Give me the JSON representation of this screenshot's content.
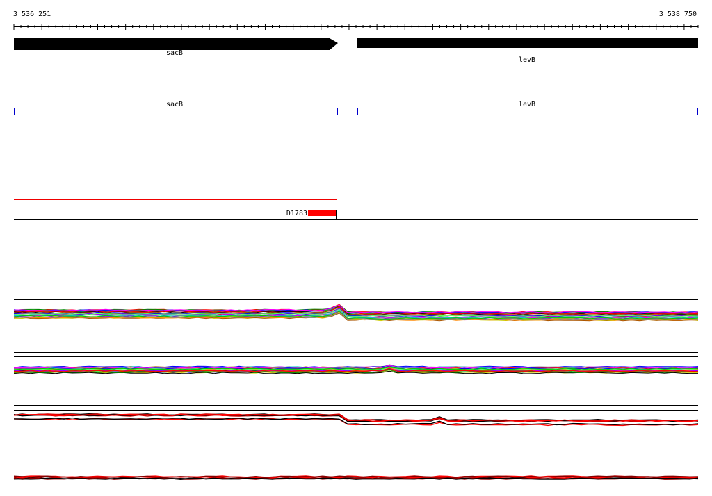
{
  "ruler": {
    "start_label": "3 536 251",
    "end_label": "3 538 750"
  },
  "genes": [
    {
      "name": "sacB"
    },
    {
      "name": "levB"
    }
  ],
  "annotations": [
    {
      "name": "sacB"
    },
    {
      "name": "levB"
    }
  ],
  "feature": {
    "label": "D1783",
    "color": "#ff0000"
  },
  "colors": {
    "gene_arrow": "#000000",
    "annotation_box": "#0000cc",
    "feature_line": "#ee0000",
    "trace_palette": [
      "#ff0000",
      "#0000ff",
      "#00cc00",
      "#ff00ff",
      "#00cccc",
      "#cccc00",
      "#ff8800",
      "#8800ff",
      "#000000",
      "#888888",
      "#008800",
      "#aa5500",
      "#66ff66"
    ]
  }
}
